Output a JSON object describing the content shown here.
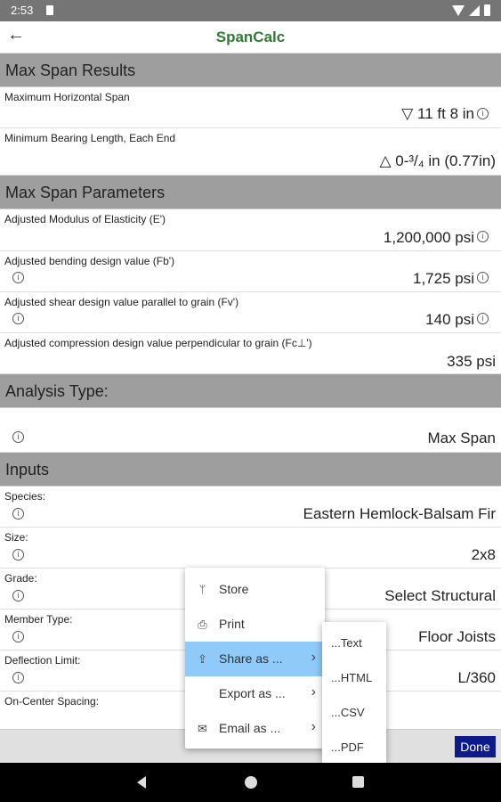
{
  "status_bar": {
    "time": "2:53"
  },
  "app_bar": {
    "back_glyph": "←",
    "title": "SpanCalc"
  },
  "sections": {
    "results": {
      "header": "Max Span Results",
      "rows": [
        {
          "label": "Maximum Horizontal Span",
          "value": "▽ 11 ft 8 in"
        },
        {
          "label": "Minimum Bearing Length, Each End",
          "value": "△ 0-³/₄ in (0.77in)"
        }
      ]
    },
    "parameters": {
      "header": "Max Span Parameters",
      "rows": [
        {
          "label": "Adjusted Modulus of Elasticity (E')",
          "value": "1,200,000 psi"
        },
        {
          "label": "Adjusted bending design value (Fb')",
          "value": "1,725 psi"
        },
        {
          "label": "Adjusted shear design value parallel to grain (Fv')",
          "value": "140 psi"
        },
        {
          "label": "Adjusted compression design value perpendicular to grain (Fc⊥')",
          "value": "335 psi"
        }
      ]
    },
    "analysis": {
      "header": "Analysis Type:",
      "value": "Max Span"
    },
    "inputs": {
      "header": "Inputs",
      "rows": [
        {
          "label": "Species:",
          "value": "Eastern Hemlock-Balsam Fir"
        },
        {
          "label": "Size:",
          "value": "2x8"
        },
        {
          "label": "Grade:",
          "value": "Select Structural"
        },
        {
          "label": "Member Type:",
          "value": "Floor Joists"
        },
        {
          "label": "Deflection Limit:",
          "value": "L/360"
        },
        {
          "label": "On-Center Spacing:",
          "value": ""
        }
      ]
    }
  },
  "toolbar": {
    "done_label": "Done"
  },
  "menu": {
    "items": [
      {
        "label": "Store",
        "icon": "ᛘ"
      },
      {
        "label": "Print",
        "icon": "⎙"
      },
      {
        "label": "Share as ...",
        "icon": "⇪",
        "arrow": "›"
      },
      {
        "label": "Export as ...",
        "icon": "",
        "arrow": "›"
      },
      {
        "label": "Email as ...",
        "icon": "✉",
        "arrow": "›"
      }
    ]
  },
  "submenu": {
    "items": [
      "...Text",
      "...HTML",
      "...CSV",
      "...PDF"
    ]
  },
  "info_glyph": "i"
}
